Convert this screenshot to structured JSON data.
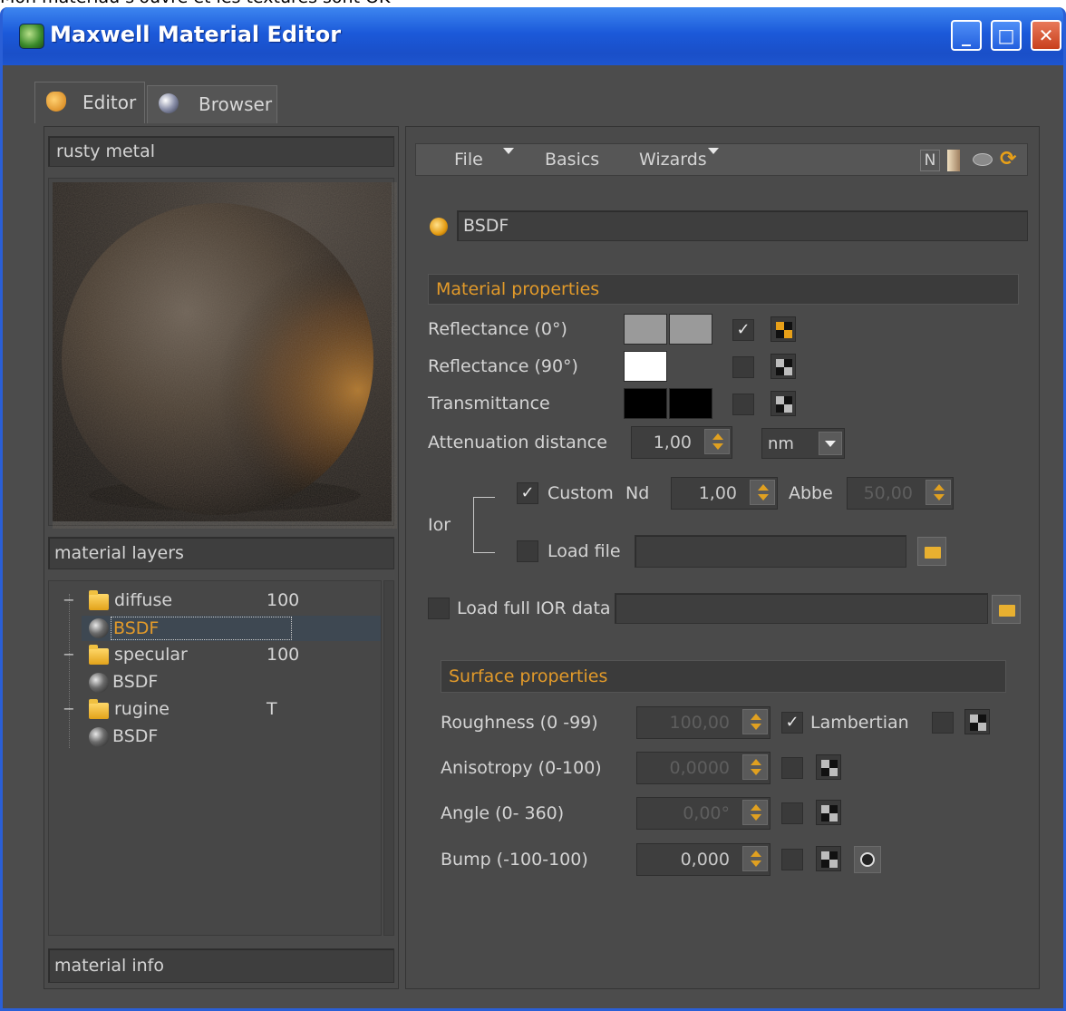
{
  "caption": "Mon matériau s'ouvre et les textures sont OK",
  "window": {
    "title": "Maxwell Material Editor",
    "min": "_",
    "max": "□",
    "close": "✕"
  },
  "tabs": [
    {
      "label": "Editor"
    },
    {
      "label": "Browser"
    }
  ],
  "left": {
    "material_name": "rusty metal",
    "layers_header": "material layers",
    "info_header": "material info",
    "tree": [
      {
        "label": "diffuse",
        "value": "100",
        "type": "folder"
      },
      {
        "label": "BSDF",
        "value": "",
        "type": "bsdf",
        "selected": true
      },
      {
        "label": "specular",
        "value": "100",
        "type": "folder"
      },
      {
        "label": "BSDF",
        "value": "",
        "type": "bsdf"
      },
      {
        "label": "rugine",
        "value": "T",
        "type": "folder"
      },
      {
        "label": "BSDF",
        "value": "",
        "type": "bsdf"
      }
    ]
  },
  "menu": {
    "file": "File",
    "basics": "Basics",
    "wizards": "Wizards",
    "n": "N"
  },
  "bsdf_name": "BSDF",
  "material_properties": {
    "header": "Material properties",
    "reflectance0": "Reflectance  (0°)",
    "reflectance90": "Reflectance  (90°)",
    "transmittance": "Transmittance",
    "attenuation": "Attenuation distance",
    "attenuation_value": "1,00",
    "attenuation_unit": "nm",
    "ior": "Ior",
    "custom": "Custom",
    "nd": "Nd",
    "nd_value": "1,00",
    "abbe": "Abbe",
    "abbe_value": "50,00",
    "load_file": "Load file",
    "load_full_ior": "Load full IOR data"
  },
  "surface_properties": {
    "header": "Surface properties",
    "roughness": "Roughness (0 -99)",
    "roughness_value": "100,00",
    "lambertian": "Lambertian",
    "anisotropy": "Anisotropy (0-100)",
    "anisotropy_value": "0,0000",
    "angle": "Angle (0- 360)",
    "angle_value": "0,00°",
    "bump": "Bump (-100-100)",
    "bump_value": "0,000"
  },
  "colors": {
    "accent": "#e29a2a",
    "titlebar": "#1b59d9",
    "background": "#4c4c4c"
  }
}
